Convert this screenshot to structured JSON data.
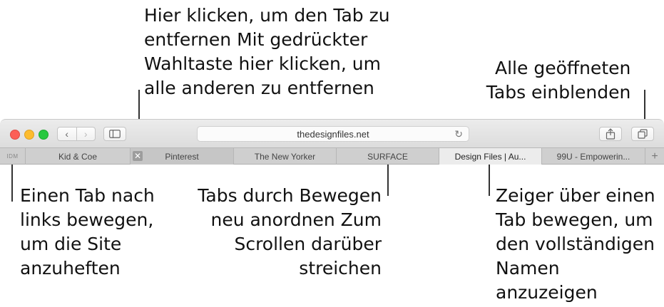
{
  "annotations": {
    "close_tab": [
      "Hier klicken, um den Tab zu",
      "entfernen Mit gedrückter",
      "Wahltaste hier klicken, um",
      "alle anderen zu entfernen"
    ],
    "show_all_tabs": [
      "Alle geöffneten",
      "Tabs einblenden"
    ],
    "pin_tab": [
      "Einen Tab nach",
      "links bewegen,",
      "um die Site",
      "anzuheften"
    ],
    "rearrange_tabs": [
      "Tabs durch Bewegen",
      "neu anordnen Zum",
      "Scrollen darüber",
      "streichen"
    ],
    "hover_tab": [
      "Zeiger über einen",
      "Tab bewegen, um",
      "den vollständigen",
      "Namen",
      "anzuzeigen"
    ]
  },
  "toolbar": {
    "back_glyph": "‹",
    "forward_glyph": "›",
    "address": "thedesignfiles.net",
    "reload_glyph": "↻",
    "share_glyph": "⇧",
    "tab_overview_glyph": "⧉"
  },
  "tabs": {
    "pinned_label": "IDM",
    "close_glyph": "✕",
    "items": [
      "Kid & Coe",
      "Pinterest",
      "The New Yorker",
      "SURFACE",
      "Design Files | Au...",
      "99U - Empowerin..."
    ],
    "new_tab_glyph": "+"
  },
  "icons": {
    "sidebar": "sidebar-icon",
    "share": "share-icon",
    "tabs_overview": "tabs-overview-icon"
  },
  "colors": {
    "close": "#fc5f57",
    "minimize": "#fdbc2e",
    "zoom": "#28c840"
  }
}
